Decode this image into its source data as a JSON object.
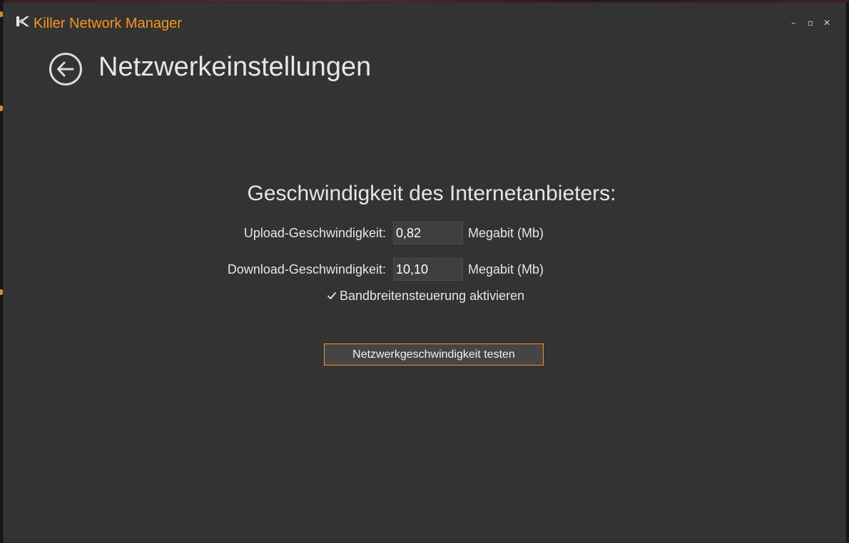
{
  "window": {
    "title": "Killer Network Manager",
    "controls": {
      "minimize": "–",
      "maximize": "▫",
      "close": "✕"
    }
  },
  "page": {
    "title": "Netzwerkeinstellungen"
  },
  "speed": {
    "heading": "Geschwindigkeit des Internetanbieters:",
    "upload": {
      "label": "Upload-Geschwindigkeit:",
      "value": "0,82",
      "unit": "Megabit (Mb)"
    },
    "download": {
      "label": "Download-Geschwindigkeit:",
      "value": "10,10",
      "unit": "Megabit (Mb)"
    },
    "bandwidth_control": {
      "label": "Bandbreitensteuerung aktivieren",
      "checked": true
    },
    "test_button": "Netzwerkgeschwindigkeit testen"
  },
  "colors": {
    "accent": "#f7941d",
    "background": "#333333",
    "text": "#e6e6e6"
  },
  "icons": {
    "back": "arrow-left-circle-icon",
    "logo": "killer-k-logo-icon",
    "check": "checkmark-icon"
  }
}
